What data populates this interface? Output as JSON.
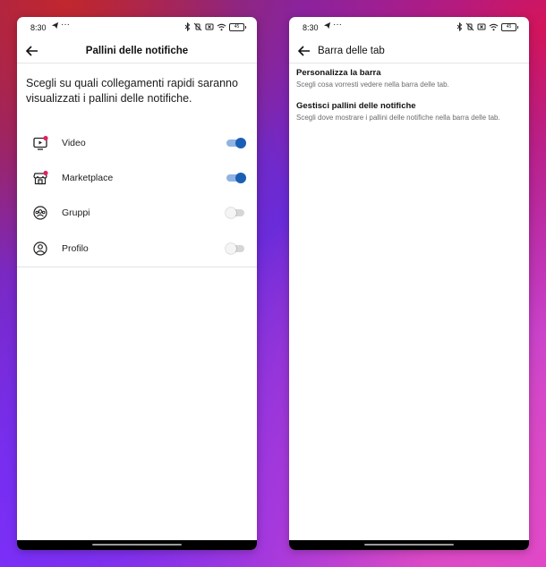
{
  "status_bar": {
    "time": "8:30",
    "dots": "···",
    "battery": "45"
  },
  "left_screen": {
    "title": "Pallini delle notifiche",
    "description": "Scegli su quali collegamenti rapidi saranno visualizzati i pallini delle notifiche.",
    "options": [
      {
        "label": "Video",
        "icon": "video-icon",
        "enabled": true
      },
      {
        "label": "Marketplace",
        "icon": "marketplace-icon",
        "enabled": true
      },
      {
        "label": "Gruppi",
        "icon": "groups-icon",
        "enabled": false
      },
      {
        "label": "Profilo",
        "icon": "profile-icon",
        "enabled": false
      }
    ]
  },
  "right_screen": {
    "title": "Barra delle tab",
    "items": [
      {
        "title": "Personalizza la barra",
        "subtitle": "Scegli cosa vorresti vedere nella barra delle tab."
      },
      {
        "title": "Gestisci pallini delle notifiche",
        "subtitle": "Scegli dove mostrare i pallini delle notifiche nella barra delle tab."
      }
    ]
  },
  "colors": {
    "toggle_on_knob": "#1b5fb5",
    "toggle_on_track": "#8fb3e3",
    "notification_dot": "#e0245e"
  }
}
